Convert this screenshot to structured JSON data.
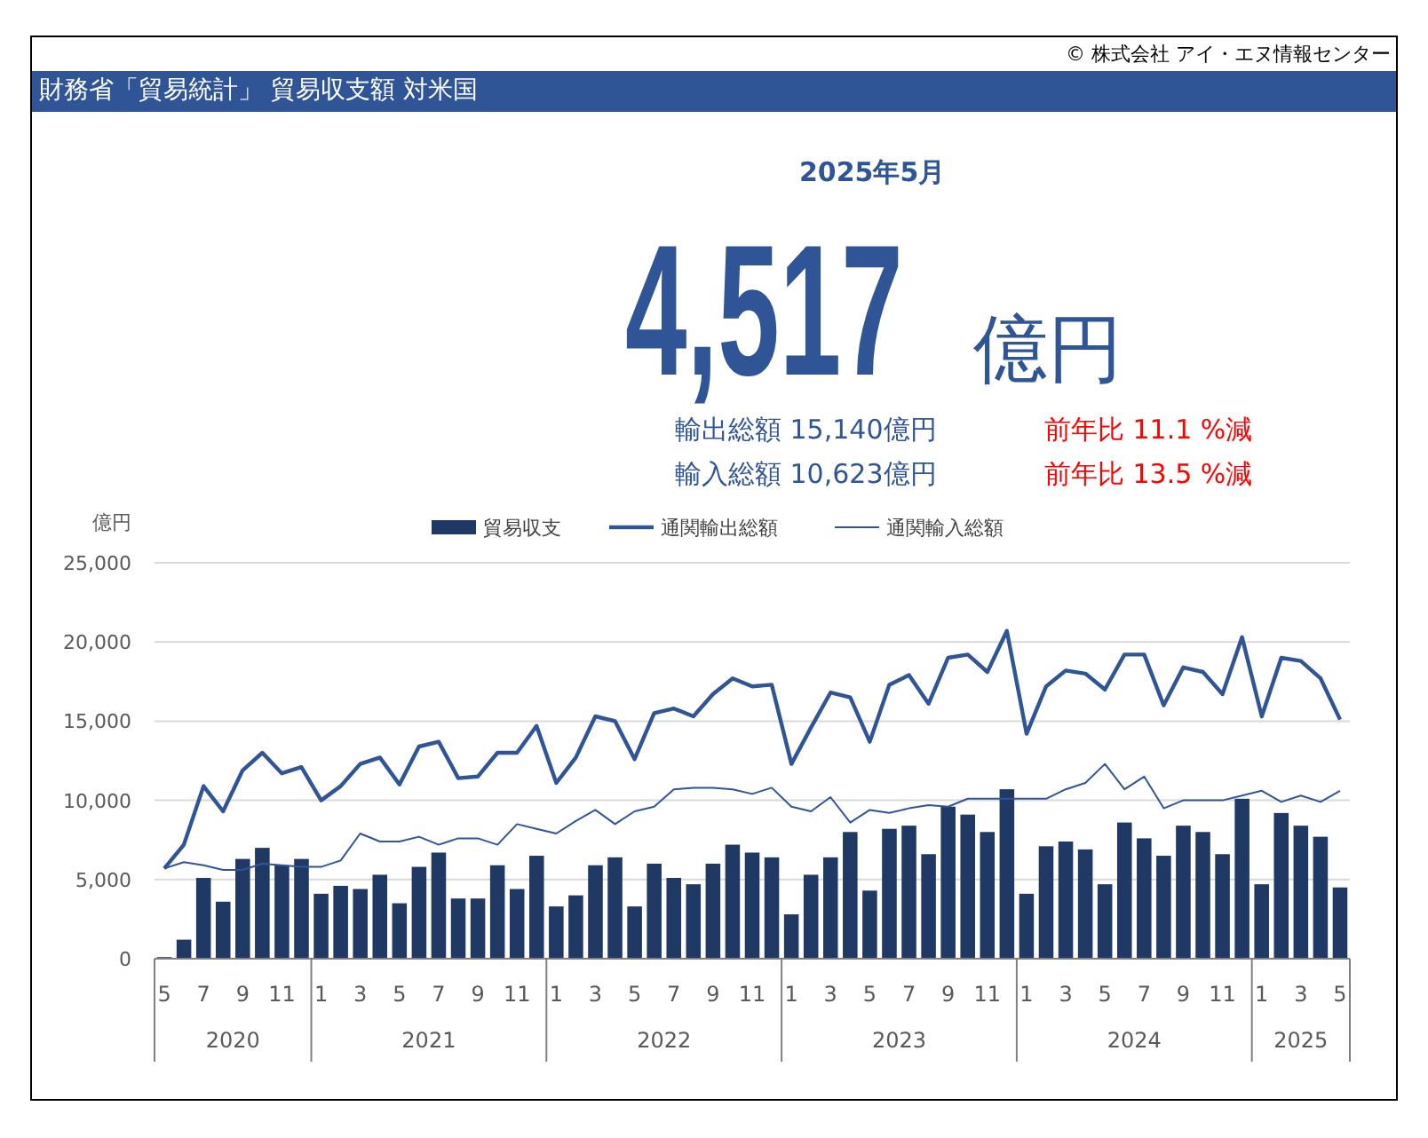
{
  "copyright": "© 株式会社 アイ・エヌ情報センター",
  "title": "財務省「貿易統計」 貿易収支額 対米国",
  "period": "2025年5月",
  "headline": {
    "value": "4,517",
    "unit": "億円"
  },
  "details": [
    {
      "label": "輸出総額 15,140億円",
      "change": "前年比 11.1 %減"
    },
    {
      "label": "輸入総額 10,623億円",
      "change": "前年比 13.5 %減"
    }
  ],
  "chart_data": {
    "type": "bar",
    "ylabel": "億円",
    "ylim": [
      0,
      25000
    ],
    "yticks": [
      {
        "value": 0,
        "label": "0"
      },
      {
        "value": 5000,
        "label": "5,000"
      },
      {
        "value": 10000,
        "label": "10,000"
      },
      {
        "value": 15000,
        "label": "15,000"
      },
      {
        "value": 20000,
        "label": "20,000"
      },
      {
        "value": 25000,
        "label": "25,000"
      }
    ],
    "grid": true,
    "legend": "top",
    "categories": [
      "5",
      null,
      "7",
      null,
      "9",
      null,
      "11",
      null,
      "1",
      null,
      "3",
      null,
      "5",
      null,
      "7",
      null,
      "9",
      null,
      "11",
      null,
      "1",
      null,
      "3",
      null,
      "5",
      null,
      "7",
      null,
      "9",
      null,
      "11",
      null,
      "1",
      null,
      "3",
      null,
      "5",
      null,
      "7",
      null,
      "9",
      null,
      "11",
      null,
      "1",
      null,
      "3",
      null,
      "5",
      null,
      "7",
      null,
      "9",
      null,
      "11",
      null,
      "1",
      null,
      "3",
      null,
      "5"
    ],
    "annotations": [
      "2020",
      "2021",
      "2022",
      "2023",
      "2024",
      "2025"
    ],
    "series": [
      {
        "name": "貿易収支",
        "type": "bar",
        "color": "#203864",
        "values": [
          100,
          1200,
          5100,
          3600,
          6300,
          7000,
          5900,
          6300,
          4100,
          4600,
          4400,
          5300,
          3500,
          5800,
          6700,
          3800,
          3800,
          5900,
          4400,
          6500,
          3300,
          4000,
          5900,
          6400,
          3300,
          6000,
          5100,
          4700,
          6000,
          7200,
          6700,
          6400,
          2800,
          5300,
          6400,
          8000,
          4300,
          8200,
          8400,
          6600,
          9600,
          9100,
          8000,
          10700,
          4100,
          7100,
          7400,
          6900,
          4700,
          8600,
          7600,
          6500,
          8400,
          8000,
          6600,
          10100,
          4700,
          9200,
          8400,
          7700,
          4500
        ]
      },
      {
        "name": "通関輸出総額",
        "type": "line",
        "color": "#2f5597",
        "values": [
          5700,
          7200,
          10900,
          9300,
          11900,
          13000,
          11700,
          12100,
          10000,
          10900,
          12300,
          12700,
          11000,
          13400,
          13700,
          11400,
          11500,
          13000,
          13000,
          14700,
          11100,
          12700,
          15300,
          15000,
          12600,
          15500,
          15800,
          15300,
          16700,
          17700,
          17200,
          17300,
          12300,
          14600,
          16800,
          16500,
          13700,
          17300,
          17900,
          16100,
          19000,
          19200,
          18100,
          20700,
          14200,
          17200,
          18200,
          18000,
          17000,
          19200,
          19200,
          16000,
          18400,
          18100,
          16700,
          20300,
          15300,
          19000,
          18800,
          17700,
          15100
        ]
      },
      {
        "name": "通関輸入総額",
        "type": "line",
        "color": "#2f5597",
        "values": [
          5700,
          6100,
          5900,
          5600,
          5600,
          6000,
          5900,
          5800,
          5800,
          6200,
          7900,
          7400,
          7400,
          7700,
          7200,
          7600,
          7600,
          7200,
          8500,
          8200,
          7900,
          8700,
          9400,
          8500,
          9300,
          9600,
          10700,
          10800,
          10800,
          10700,
          10400,
          10800,
          9600,
          9300,
          10200,
          8600,
          9400,
          9200,
          9500,
          9700,
          9600,
          10100,
          10100,
          10100,
          10100,
          10100,
          10700,
          11100,
          12300,
          10700,
          11500,
          9500,
          10000,
          10000,
          10000,
          10300,
          10600,
          9900,
          10300,
          9900,
          10600
        ]
      }
    ]
  }
}
